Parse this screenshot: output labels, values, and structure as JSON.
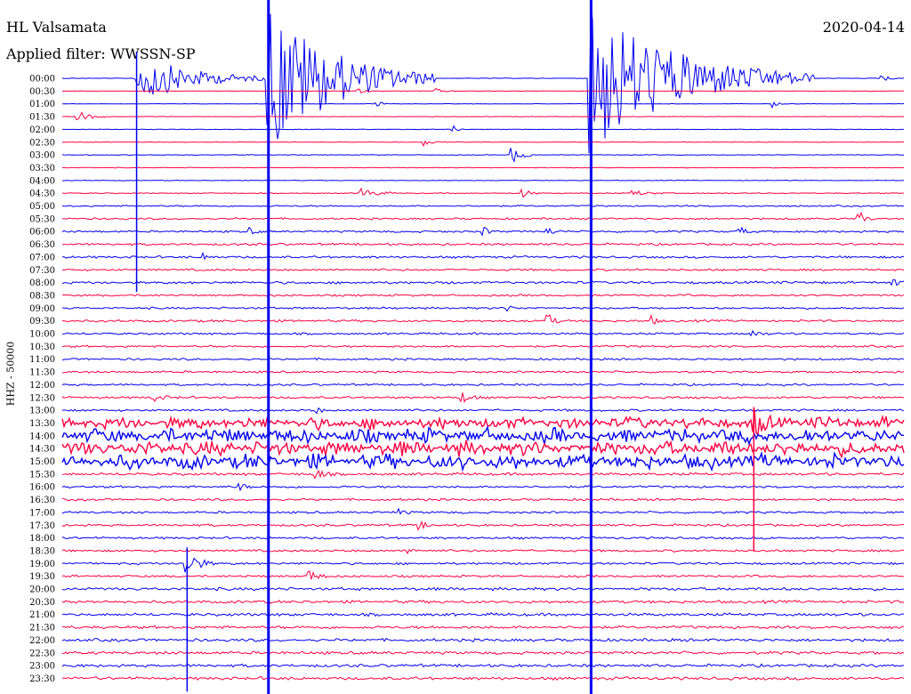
{
  "header": {
    "station": "HL Valsamata",
    "filter_label": "Applied filter: WWSSN-SP",
    "date": "2020-04-14"
  },
  "chart_data": {
    "type": "helicorder",
    "ylabel": "HHZ - 50000",
    "row_colors": [
      "#0000ee",
      "#ff0040"
    ],
    "hours": [
      "00:00",
      "00:30",
      "01:00",
      "01:30",
      "02:00",
      "02:30",
      "03:00",
      "03:30",
      "04:00",
      "04:30",
      "05:00",
      "05:30",
      "06:00",
      "06:30",
      "07:00",
      "07:30",
      "08:00",
      "08:30",
      "09:00",
      "09:30",
      "10:00",
      "10:30",
      "11:00",
      "11:30",
      "12:00",
      "12:30",
      "13:00",
      "13:30",
      "14:00",
      "14:30",
      "15:00",
      "15:30",
      "16:00",
      "16:30",
      "17:00",
      "17:30",
      "18:00",
      "18:30",
      "19:00",
      "19:30",
      "20:00",
      "20:30",
      "21:00",
      "21:30",
      "22:00",
      "22:30",
      "23:00",
      "23:30"
    ],
    "row_noise": [
      0.2,
      0.2,
      0.2,
      0.2,
      0.25,
      0.25,
      0.3,
      0.3,
      0.3,
      0.4,
      0.7,
      0.8,
      0.9,
      1.0,
      1.0,
      0.9,
      1.1,
      0.9,
      0.9,
      1.0,
      0.9,
      0.9,
      0.9,
      0.9,
      0.9,
      1.0,
      1.0,
      4.0,
      5.0,
      5.0,
      5.0,
      1.2,
      1.0,
      1.0,
      1.0,
      1.0,
      1.0,
      1.0,
      1.0,
      1.0,
      1.3,
      1.3,
      1.3,
      1.3,
      1.3,
      1.3,
      1.3,
      1.3
    ],
    "minute_range": [
      0,
      30
    ],
    "events": [
      {
        "row": 3,
        "minute": 0.4,
        "amp": 9,
        "dur": 1.2
      },
      {
        "row": 0,
        "minute": 2.6,
        "amp": 30,
        "dur": 5,
        "trail": true
      },
      {
        "row": 0,
        "minute": 7.3,
        "amp": 90,
        "dur": 6,
        "trail": true
      },
      {
        "row": 0,
        "minute": 18.8,
        "amp": 90,
        "dur": 8,
        "trail": true
      },
      {
        "row": 0,
        "minute": 29.2,
        "amp": 7,
        "dur": 0.6
      },
      {
        "row": 1,
        "minute": 10.5,
        "amp": 3,
        "dur": 0.8
      },
      {
        "row": 1,
        "minute": 13.3,
        "amp": 3,
        "dur": 0.8
      },
      {
        "row": 2,
        "minute": 11.2,
        "amp": 5,
        "dur": 0.4
      },
      {
        "row": 2,
        "minute": 25.3,
        "amp": 5,
        "dur": 0.4
      },
      {
        "row": 4,
        "minute": 13.9,
        "amp": 6,
        "dur": 0.4
      },
      {
        "row": 5,
        "minute": 12.9,
        "amp": 4,
        "dur": 0.6
      },
      {
        "row": 6,
        "minute": 16.0,
        "amp": 10,
        "dur": 1.0
      },
      {
        "row": 9,
        "minute": 10.6,
        "amp": 6,
        "dur": 1.5
      },
      {
        "row": 9,
        "minute": 16.3,
        "amp": 7,
        "dur": 0.7
      },
      {
        "row": 9,
        "minute": 20.3,
        "amp": 4,
        "dur": 1.2
      },
      {
        "row": 11,
        "minute": 28.4,
        "amp": 10,
        "dur": 0.5
      },
      {
        "row": 12,
        "minute": 6.6,
        "amp": 5,
        "dur": 0.6
      },
      {
        "row": 12,
        "minute": 15.0,
        "amp": 5,
        "dur": 0.6
      },
      {
        "row": 12,
        "minute": 17.3,
        "amp": 5,
        "dur": 0.6
      },
      {
        "row": 12,
        "minute": 24.1,
        "amp": 7,
        "dur": 0.6
      },
      {
        "row": 14,
        "minute": 5.0,
        "amp": 5,
        "dur": 0.6
      },
      {
        "row": 16,
        "minute": 29.6,
        "amp": 5,
        "dur": 0.5
      },
      {
        "row": 18,
        "minute": 15.9,
        "amp": 4,
        "dur": 0.5
      },
      {
        "row": 19,
        "minute": 17.3,
        "amp": 10,
        "dur": 0.5
      },
      {
        "row": 19,
        "minute": 21.0,
        "amp": 5,
        "dur": 0.5
      },
      {
        "row": 20,
        "minute": 24.5,
        "amp": 5,
        "dur": 0.8
      },
      {
        "row": 25,
        "minute": 3.2,
        "amp": 4,
        "dur": 1.0
      },
      {
        "row": 25,
        "minute": 14.2,
        "amp": 7,
        "dur": 0.8
      },
      {
        "row": 26,
        "minute": 9.0,
        "amp": 4,
        "dur": 0.6
      },
      {
        "row": 27,
        "minute": 24.6,
        "amp": 18,
        "dur": 0.8,
        "trail": true
      },
      {
        "row": 28,
        "minute": 5.0,
        "amp": 6,
        "dur": 0.4
      },
      {
        "row": 30,
        "minute": 14.3,
        "amp": 5,
        "dur": 0.7
      },
      {
        "row": 31,
        "minute": 9.0,
        "amp": 10,
        "dur": 0.6
      },
      {
        "row": 32,
        "minute": 6.3,
        "amp": 6,
        "dur": 0.5
      },
      {
        "row": 34,
        "minute": 12.0,
        "amp": 3,
        "dur": 0.6
      },
      {
        "row": 35,
        "minute": 12.7,
        "amp": 6,
        "dur": 0.5
      },
      {
        "row": 37,
        "minute": 12.3,
        "amp": 4,
        "dur": 0.6
      },
      {
        "row": 38,
        "minute": 4.4,
        "amp": 18,
        "dur": 1.0,
        "trail": true
      },
      {
        "row": 39,
        "minute": 8.8,
        "amp": 7,
        "dur": 0.8
      }
    ]
  }
}
